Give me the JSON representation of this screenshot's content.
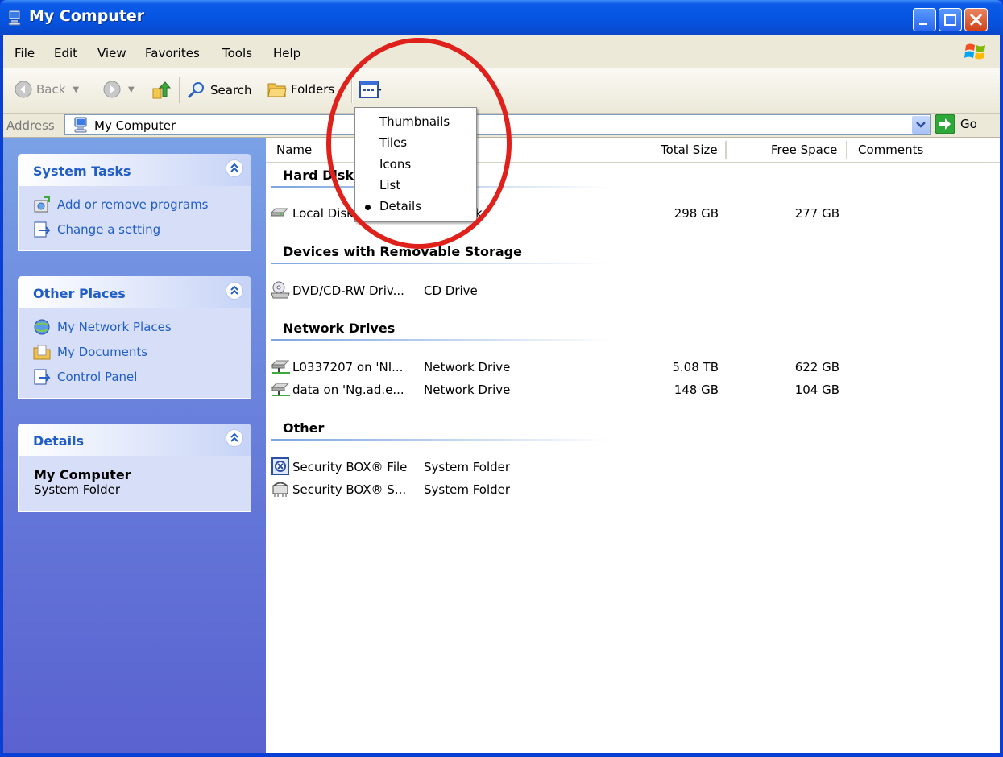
{
  "window": {
    "title": "My Computer"
  },
  "menu": [
    "File",
    "Edit",
    "View",
    "Favorites",
    "Tools",
    "Help"
  ],
  "toolbar": {
    "back": "Back",
    "search": "Search",
    "folders": "Folders"
  },
  "address": {
    "label": "Address",
    "value": "My Computer",
    "go": "Go"
  },
  "left_panels": {
    "system_tasks": {
      "title": "System Tasks",
      "items": [
        "Add or remove programs",
        "Change a setting"
      ]
    },
    "other_places": {
      "title": "Other Places",
      "items": [
        "My Network Places",
        "My Documents",
        "Control Panel"
      ]
    },
    "details": {
      "title": "Details",
      "name": "My Computer",
      "type": "System Folder"
    }
  },
  "columns": {
    "name": "Name",
    "total_size": "Total Size",
    "free_space": "Free Space",
    "comments": "Comments"
  },
  "groups": {
    "hard_disk": "Hard Disk",
    "removable": "Devices with Removable Storage",
    "network": "Network Drives",
    "other": "Other"
  },
  "rows": {
    "local_disk": {
      "name": "Local Disk",
      "type_tail": "k",
      "total": "298 GB",
      "free": "277 GB"
    },
    "dvd": {
      "name": "DVD/CD-RW Driv...",
      "type": "CD Drive"
    },
    "net1": {
      "name": "L0337207 on 'NI...",
      "type": "Network Drive",
      "total": "5.08 TB",
      "free": "622 GB"
    },
    "net2": {
      "name": "data on 'Ng.ad.e...",
      "type": "Network Drive",
      "total": "148 GB",
      "free": "104 GB"
    },
    "sec1": {
      "name": "Security BOX® File",
      "type": "System Folder"
    },
    "sec2": {
      "name": "Security BOX® S...",
      "type": "System Folder"
    }
  },
  "view_menu": [
    "Thumbnails",
    "Tiles",
    "Icons",
    "List",
    "Details"
  ],
  "colors": {
    "accent": "#215dc6",
    "annotation": "#e0201a",
    "titlebar": "#0554e0"
  }
}
